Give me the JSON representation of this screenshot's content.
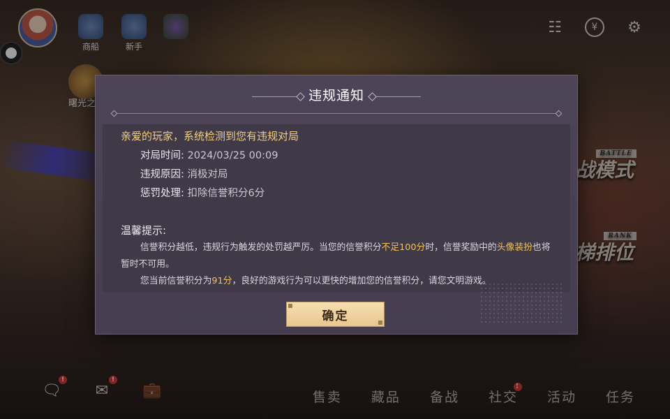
{
  "top": {
    "shop_label": "商船",
    "newbie_label": "新手",
    "dawn_label": "曙光之"
  },
  "modes": {
    "battle": "战模式",
    "battle_tag": "BATTLE",
    "rank": "梯排位",
    "rank_tag": "RANK"
  },
  "dialog": {
    "title": "违规通知",
    "greeting": "亲爱的玩家，系统检测到您有违规对局",
    "match_time_label": "对局时间:",
    "match_time_value": "2024/03/25 00:09",
    "reason_label": "违规原因:",
    "reason_value": "消极对局",
    "penalty_label": "惩罚处理:",
    "penalty_value": "扣除信誉积分6分",
    "tip_heading": "温馨提示:",
    "tip1_a": "信誉积分越低，违规行为触发的处罚越严厉。当您的信誉积分",
    "tip1_b": "不足100分",
    "tip1_c": "时，信誉奖励中的",
    "tip1_d": "头像装扮",
    "tip1_e": "也将暂时不可用。",
    "tip2_a": "您当前信誉积分为",
    "tip2_b": "91分",
    "tip2_c": "，良好的游戏行为可以更快的增加您的信誉积分，请您文明游戏。",
    "confirm_label": "确定"
  },
  "bottom_nav": {
    "sell": "售卖",
    "collection": "藏品",
    "prepare": "备战",
    "social": "社交",
    "events": "活动",
    "tasks": "任务"
  },
  "badges": {
    "mark": "!"
  },
  "colors": {
    "highlight": "#f3c35b",
    "greeting": "#f3cf84",
    "badge": "#d43a3a"
  }
}
